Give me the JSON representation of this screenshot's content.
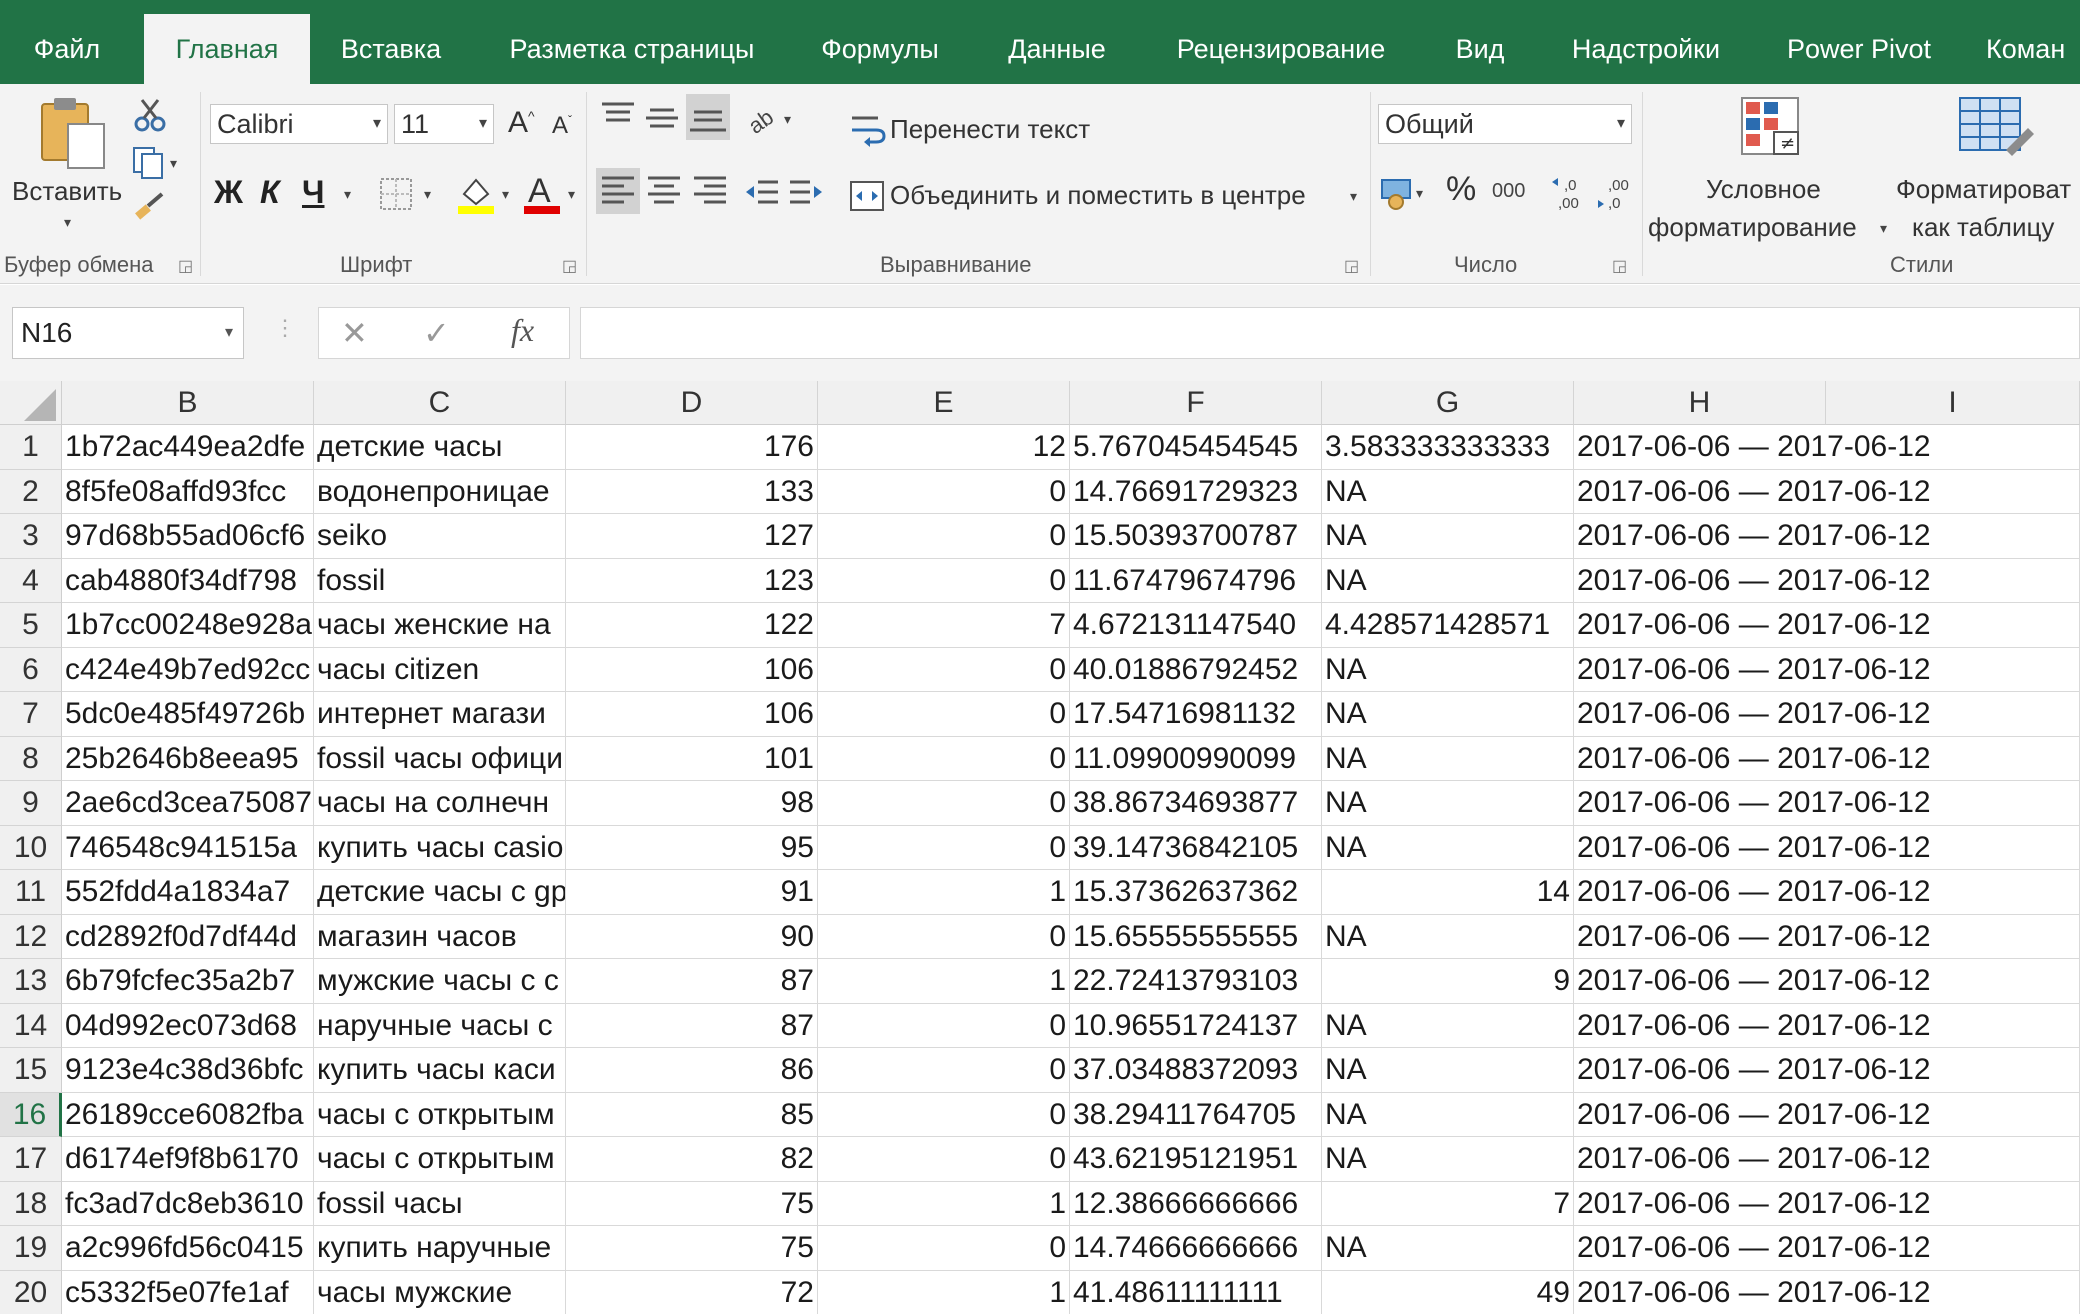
{
  "tabs": [
    {
      "label": "Файл",
      "active": false
    },
    {
      "label": "Главная",
      "active": true
    },
    {
      "label": "Вставка",
      "active": false
    },
    {
      "label": "Разметка страницы",
      "active": false
    },
    {
      "label": "Формулы",
      "active": false
    },
    {
      "label": "Данные",
      "active": false
    },
    {
      "label": "Рецензирование",
      "active": false
    },
    {
      "label": "Вид",
      "active": false
    },
    {
      "label": "Надстройки",
      "active": false
    },
    {
      "label": "Power Pivot",
      "active": false
    },
    {
      "label": "Коман",
      "active": false
    }
  ],
  "ribbon": {
    "clipboard": {
      "paste_label": "Вставить",
      "group_label": "Буфер обмена"
    },
    "font": {
      "font_name": "Calibri",
      "font_size": "11",
      "bold": "Ж",
      "italic": "К",
      "underline": "Ч",
      "group_label": "Шрифт"
    },
    "alignment": {
      "wrap_text": "Перенести текст",
      "merge_center": "Объединить и поместить в центре",
      "group_label": "Выравнивание"
    },
    "number": {
      "format": "Общий",
      "percent": "%",
      "thousands": "000",
      "group_label": "Число"
    },
    "styles": {
      "conditional_line1": "Условное",
      "conditional_line2": "форматирование",
      "table_line1": "Форматироват",
      "table_line2": "как таблицу",
      "group_label": "Стили"
    }
  },
  "formula_bar": {
    "name_box": "N16",
    "value": ""
  },
  "columns": [
    "B",
    "C",
    "D",
    "E",
    "F",
    "G",
    "H",
    "I"
  ],
  "selected_row": 16,
  "colors": {
    "accent": "#217346",
    "tab_text": "#ffffff"
  },
  "rows": [
    {
      "n": "1",
      "b": "1b72ac449ea2dfe",
      "c": "детские часы",
      "d": "176",
      "e": "12",
      "f": "5.767045454545",
      "g": "3.583333333333",
      "h": "2017-06-06 — 2017-06-12"
    },
    {
      "n": "2",
      "b": "8f5fe08affd93fcc",
      "c": "водонепроницае",
      "d": "133",
      "e": "0",
      "f": "14.76691729323",
      "g": "NA",
      "h": "2017-06-06 — 2017-06-12"
    },
    {
      "n": "3",
      "b": "97d68b55ad06cf6",
      "c": "seiko",
      "d": "127",
      "e": "0",
      "f": "15.50393700787",
      "g": "NA",
      "h": "2017-06-06 — 2017-06-12"
    },
    {
      "n": "4",
      "b": "cab4880f34df798",
      "c": "fossil",
      "d": "123",
      "e": "0",
      "f": "11.67479674796",
      "g": "NA",
      "h": "2017-06-06 — 2017-06-12"
    },
    {
      "n": "5",
      "b": "1b7cc00248e928a",
      "c": "часы женские на",
      "d": "122",
      "e": "7",
      "f": "4.672131147540",
      "g": "4.428571428571",
      "h": "2017-06-06 — 2017-06-12"
    },
    {
      "n": "6",
      "b": "c424e49b7ed92cc",
      "c": "часы citizen",
      "d": "106",
      "e": "0",
      "f": "40.01886792452",
      "g": "NA",
      "h": "2017-06-06 — 2017-06-12"
    },
    {
      "n": "7",
      "b": "5dc0e485f49726b",
      "c": "интернет магази",
      "d": "106",
      "e": "0",
      "f": "17.54716981132",
      "g": "NA",
      "h": "2017-06-06 — 2017-06-12"
    },
    {
      "n": "8",
      "b": "25b2646b8eea95",
      "c": "fossil часы офици",
      "d": "101",
      "e": "0",
      "f": "11.09900990099",
      "g": "NA",
      "h": "2017-06-06 — 2017-06-12"
    },
    {
      "n": "9",
      "b": "2ae6cd3cea75087",
      "c": "часы на солнечн",
      "d": "98",
      "e": "0",
      "f": "38.86734693877",
      "g": "NA",
      "h": "2017-06-06 — 2017-06-12"
    },
    {
      "n": "10",
      "b": "746548c941515a",
      "c": "купить часы casio",
      "d": "95",
      "e": "0",
      "f": "39.14736842105",
      "g": "NA",
      "h": "2017-06-06 — 2017-06-12"
    },
    {
      "n": "11",
      "b": "552fdd4a1834a7",
      "c": "детские часы с gp",
      "d": "91",
      "e": "1",
      "f": "15.37362637362",
      "g": "14",
      "h": "2017-06-06 — 2017-06-12"
    },
    {
      "n": "12",
      "b": "cd2892f0d7df44d",
      "c": "магазин часов",
      "d": "90",
      "e": "0",
      "f": "15.65555555555",
      "g": "NA",
      "h": "2017-06-06 — 2017-06-12"
    },
    {
      "n": "13",
      "b": "6b79fcfec35a2b7",
      "c": "мужские часы с с",
      "d": "87",
      "e": "1",
      "f": "22.72413793103",
      "g": "9",
      "h": "2017-06-06 — 2017-06-12"
    },
    {
      "n": "14",
      "b": "04d992ec073d68",
      "c": "наручные часы с",
      "d": "87",
      "e": "0",
      "f": "10.96551724137",
      "g": "NA",
      "h": "2017-06-06 — 2017-06-12"
    },
    {
      "n": "15",
      "b": "9123e4c38d36bfc",
      "c": "купить часы каси",
      "d": "86",
      "e": "0",
      "f": "37.03488372093",
      "g": "NA",
      "h": "2017-06-06 — 2017-06-12"
    },
    {
      "n": "16",
      "b": "26189cce6082fba",
      "c": "часы с открытым",
      "d": "85",
      "e": "0",
      "f": "38.29411764705",
      "g": "NA",
      "h": "2017-06-06 — 2017-06-12"
    },
    {
      "n": "17",
      "b": "d6174ef9f8b6170",
      "c": "часы с открытым",
      "d": "82",
      "e": "0",
      "f": "43.62195121951",
      "g": "NA",
      "h": "2017-06-06 — 2017-06-12"
    },
    {
      "n": "18",
      "b": "fc3ad7dc8eb3610",
      "c": "fossil часы",
      "d": "75",
      "e": "1",
      "f": "12.38666666666",
      "g": "7",
      "h": "2017-06-06 — 2017-06-12"
    },
    {
      "n": "19",
      "b": "a2c996fd56c0415",
      "c": "купить наручные",
      "d": "75",
      "e": "0",
      "f": "14.74666666666",
      "g": "NA",
      "h": "2017-06-06 — 2017-06-12"
    },
    {
      "n": "20",
      "b": "c5332f5e07fe1af",
      "c": "часы мужские",
      "d": "72",
      "e": "1",
      "f": "41.48611111111",
      "g": "49",
      "h": "2017-06-06 — 2017-06-12"
    }
  ]
}
